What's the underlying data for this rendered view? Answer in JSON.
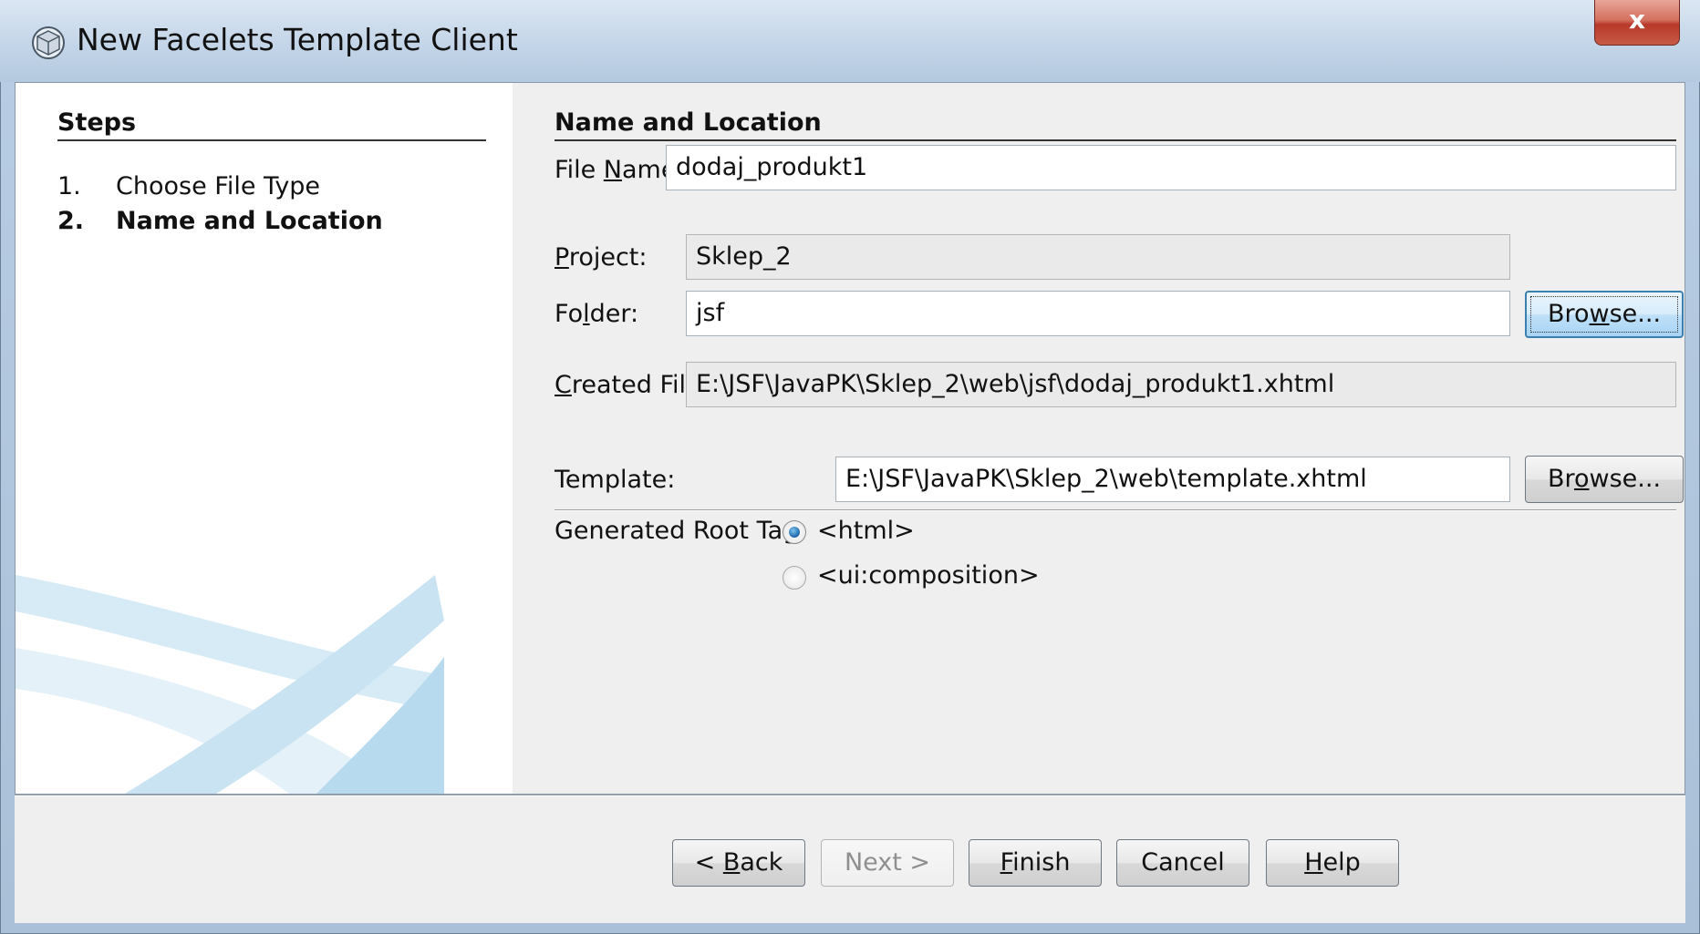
{
  "window": {
    "title": "New Facelets Template Client",
    "close_label": "x"
  },
  "steps": {
    "heading": "Steps",
    "items": [
      {
        "number": "1.",
        "label": "Choose File Type",
        "current": false
      },
      {
        "number": "2.",
        "label": "Name and Location",
        "current": true
      }
    ]
  },
  "form": {
    "section_title": "Name and Location",
    "file_name": {
      "label_pre": "File ",
      "label_mn": "N",
      "label_post": "ame:",
      "value": "dodaj_produkt1"
    },
    "project": {
      "label_mn": "P",
      "label_post": "roject:",
      "value": "Sklep_2"
    },
    "folder": {
      "label_pre": "Fo",
      "label_mn": "l",
      "label_post": "der:",
      "value": "jsf"
    },
    "folder_browse": {
      "pre": "Bro",
      "mn": "w",
      "post": "se..."
    },
    "created_file": {
      "label_mn": "C",
      "label_post": "reated File:",
      "value": "E:\\JSF\\JavaPK\\Sklep_2\\web\\jsf\\dodaj_produkt1.xhtml"
    },
    "template": {
      "label": "Template:",
      "value": "E:\\JSF\\JavaPK\\Sklep_2\\web\\template.xhtml"
    },
    "template_browse": {
      "pre": "Br",
      "mn": "o",
      "post": "wse..."
    },
    "root_tag": {
      "label": "Generated Root Tag:",
      "options": [
        {
          "label": "<html>",
          "selected": true
        },
        {
          "label": "<ui:composition>",
          "selected": false
        }
      ]
    }
  },
  "buttons": {
    "back": {
      "pre": "< ",
      "mn": "B",
      "post": "ack"
    },
    "next": {
      "label": "Next >",
      "enabled": false
    },
    "finish": {
      "mn": "F",
      "post": "inish"
    },
    "cancel": {
      "label": "Cancel"
    },
    "help": {
      "mn": "H",
      "post": "elp"
    }
  },
  "colors": {
    "accent": "#1d66a6",
    "close": "#c75a46"
  }
}
